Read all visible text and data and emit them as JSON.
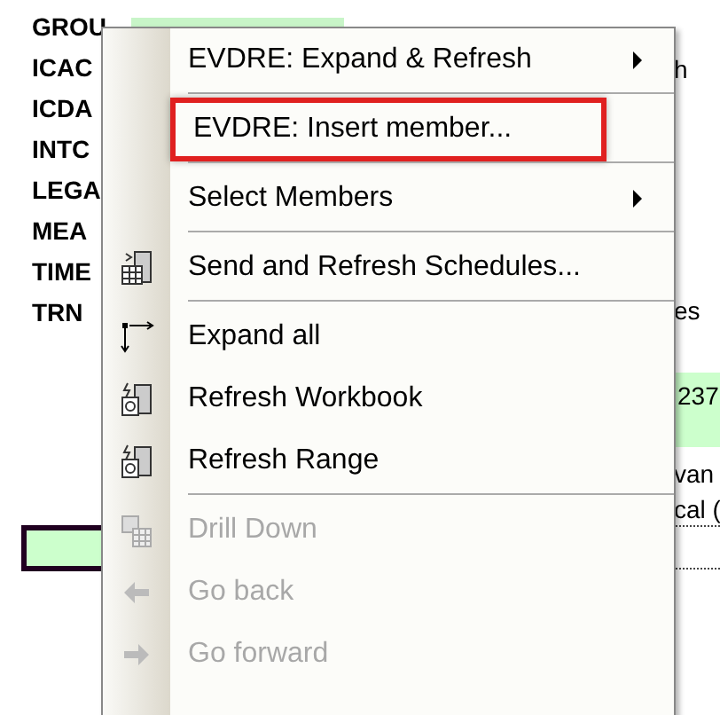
{
  "sheet": {
    "left_cells": [
      {
        "text": "GROU"
      },
      {
        "text": "ICAC"
      },
      {
        "text": "ICDA"
      },
      {
        "text": "INTC"
      },
      {
        "text": "LEGA"
      },
      {
        "text": "MEA"
      },
      {
        "text": "TIME"
      },
      {
        "text": "TRN"
      }
    ],
    "right_cells": [
      {
        "text": "h"
      },
      {
        "text": "es"
      },
      {
        "text": "237"
      },
      {
        "text": "van"
      },
      {
        "text": "cal ("
      }
    ]
  },
  "menu": {
    "items": [
      {
        "kind": "item",
        "label": "EVDRE: Expand & Refresh",
        "submenu": true,
        "disabled": false,
        "outlined": false
      },
      {
        "kind": "separator"
      },
      {
        "kind": "item",
        "label": "EVDRE: Insert member...",
        "submenu": false,
        "disabled": false,
        "outlined": true
      },
      {
        "kind": "separator"
      },
      {
        "kind": "item",
        "label": "Select Members",
        "submenu": true,
        "disabled": false,
        "outlined": false
      },
      {
        "kind": "separator"
      },
      {
        "kind": "item",
        "label": "Send and Refresh Schedules...",
        "submenu": false,
        "disabled": false,
        "outlined": false
      },
      {
        "kind": "separator"
      },
      {
        "kind": "item",
        "label": "Expand all",
        "submenu": false,
        "disabled": false,
        "outlined": false
      },
      {
        "kind": "item",
        "label": "Refresh Workbook",
        "submenu": false,
        "disabled": false,
        "outlined": false
      },
      {
        "kind": "item",
        "label": "Refresh Range",
        "submenu": false,
        "disabled": false,
        "outlined": false
      },
      {
        "kind": "separator"
      },
      {
        "kind": "item",
        "label": "Drill Down",
        "submenu": false,
        "disabled": true,
        "outlined": false
      },
      {
        "kind": "item",
        "label": "Go back",
        "submenu": false,
        "disabled": true,
        "outlined": false
      },
      {
        "kind": "item",
        "label": "Go forward",
        "submenu": false,
        "disabled": true,
        "outlined": false
      }
    ]
  }
}
